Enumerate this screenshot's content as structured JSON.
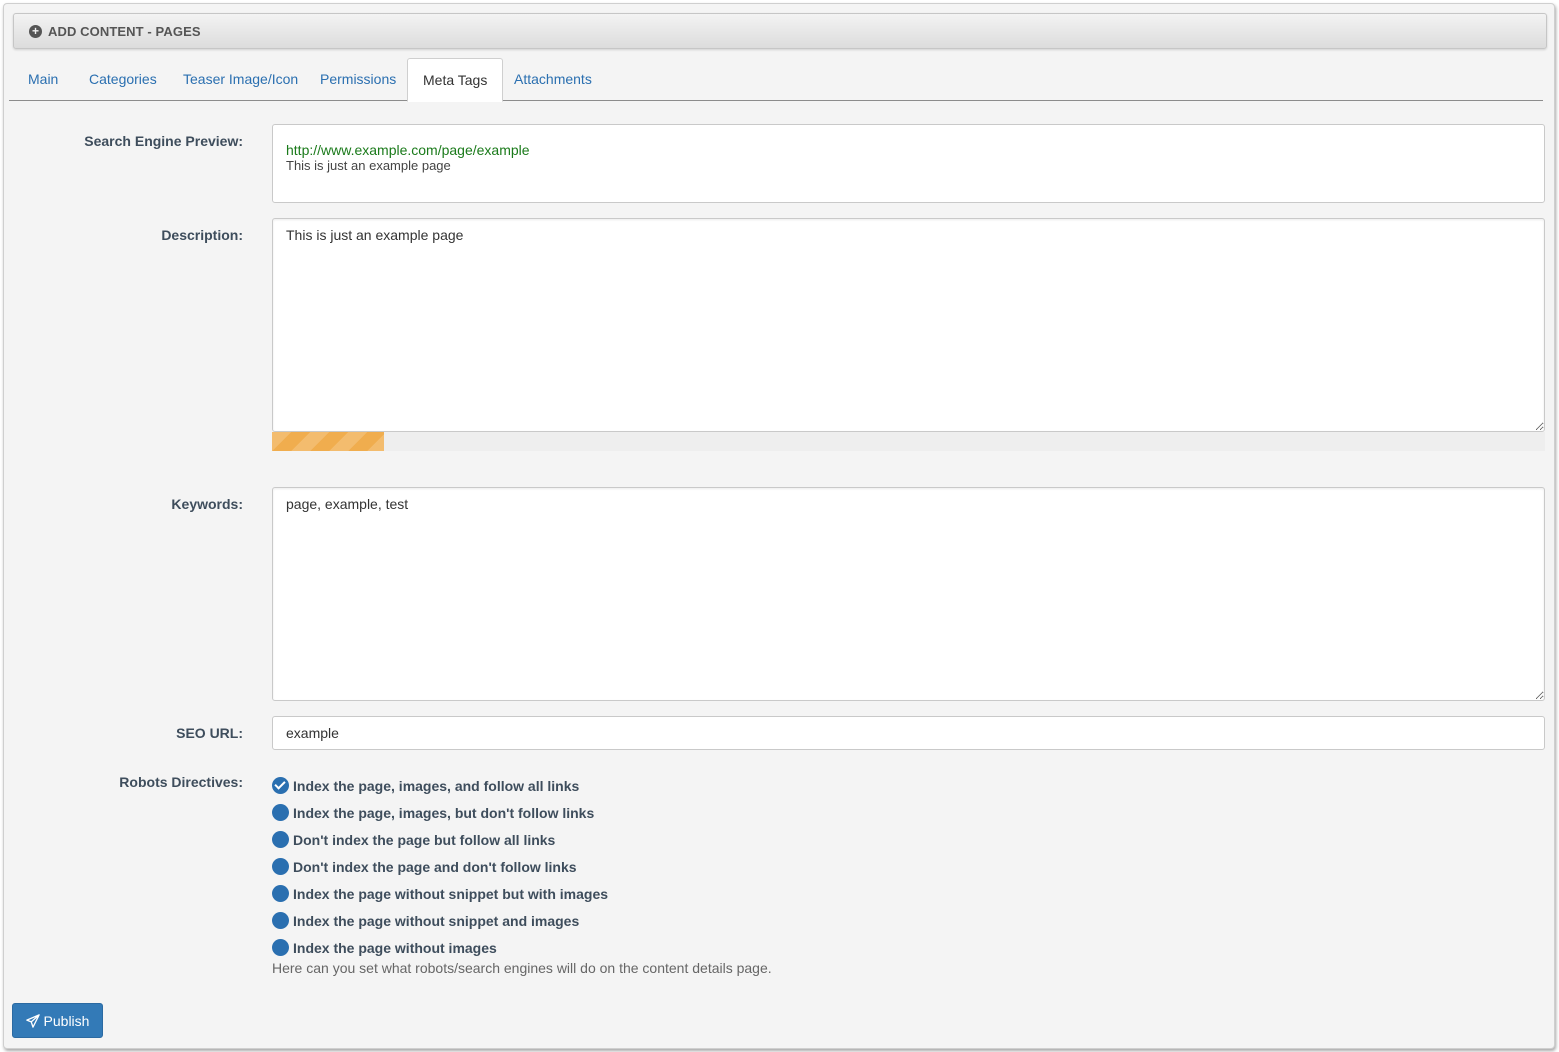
{
  "header": {
    "title": "ADD CONTENT - PAGES",
    "icon": "plus-circle-icon"
  },
  "tabs": [
    {
      "label": "Main"
    },
    {
      "label": "Categories"
    },
    {
      "label": "Teaser Image/Icon"
    },
    {
      "label": "Permissions"
    },
    {
      "label": "Meta Tags",
      "active": true
    },
    {
      "label": "Attachments"
    }
  ],
  "form": {
    "preview": {
      "label": "Search Engine Preview:",
      "url": "http://www.example.com/page/example",
      "description": "This is just an example page"
    },
    "description": {
      "label": "Description:",
      "value": "This is just an example page",
      "progress_fraction": 0.088,
      "progress_color": "#f0ad4e"
    },
    "keywords": {
      "label": "Keywords:",
      "value": "page, example, test"
    },
    "seo_url": {
      "label": "SEO URL:",
      "value": "example"
    },
    "robots": {
      "label": "Robots Directives:",
      "options": [
        {
          "label": "Index the page, images, and follow all links",
          "checked": true
        },
        {
          "label": "Index the page, images, but don't follow links",
          "checked": false
        },
        {
          "label": "Don't index the page but follow all links",
          "checked": false
        },
        {
          "label": "Don't index the page and don't follow links",
          "checked": false
        },
        {
          "label": "Index the page without snippet but with images",
          "checked": false
        },
        {
          "label": "Index the page without snippet and images",
          "checked": false
        },
        {
          "label": "Index the page without images",
          "checked": false
        }
      ],
      "help": "Here can you set what robots/search engines will do on the content details page."
    }
  },
  "actions": {
    "publish_label": "Publish",
    "publish_icon": "paper-plane-icon"
  },
  "colors": {
    "accent": "#337ab7",
    "link": "#2a6fb0",
    "preview_url": "#1a7a1a"
  }
}
